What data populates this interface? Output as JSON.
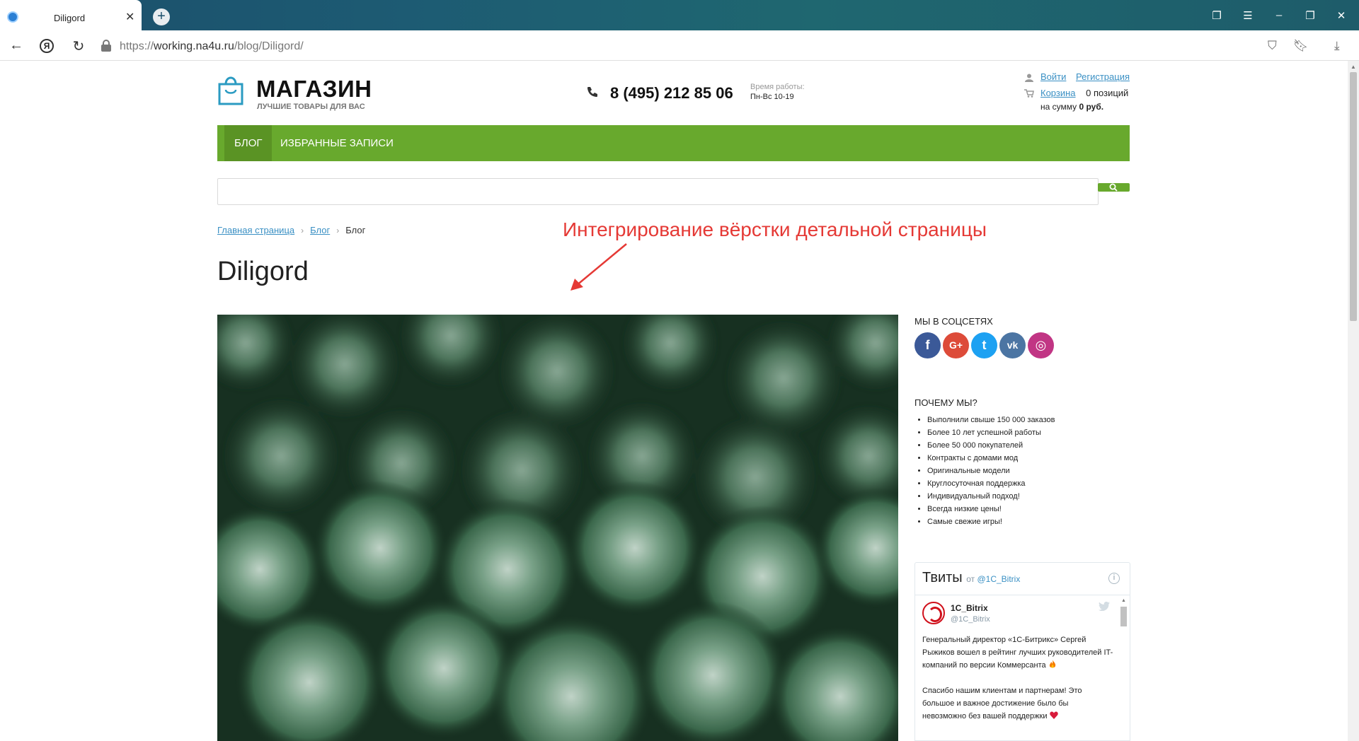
{
  "browser": {
    "tab_title": "Diligord",
    "url_prefix": "https://",
    "url_domain": "working.na4u.ru",
    "url_path": "/blog/Diligord/"
  },
  "header": {
    "logo_name": "МАГАЗИН",
    "logo_slogan": "ЛУЧШИЕ ТОВАРЫ ДЛЯ ВАС",
    "phone": "8 (495) 212 85 06",
    "hours_label": "Время работы:",
    "hours_value": "Пн-Вс 10-19",
    "login_link": "Войти",
    "register_link": "Регистрация",
    "cart_link": "Корзина",
    "cart_count": "0 позиций",
    "cart_sum_label": "на сумму",
    "cart_sum_value": "0 руб."
  },
  "menu": {
    "items": [
      {
        "label": "БЛОГ",
        "active": true
      },
      {
        "label": "ИЗБРАННЫЕ ЗАПИСИ",
        "active": false
      }
    ]
  },
  "search": {
    "placeholder": ""
  },
  "breadcrumbs": {
    "items": [
      {
        "label": "Главная страница",
        "link": true
      },
      {
        "label": "Блог",
        "link": true
      },
      {
        "label": "Блог",
        "link": false
      }
    ]
  },
  "annotation": "Интегрирование вёрстки детальной страницы",
  "page_title": "Diligord",
  "sidebar": {
    "social_title": "МЫ В СОЦСЕТЯХ",
    "social": [
      {
        "name": "facebook-icon",
        "glyph": "f",
        "color": "#3b5998"
      },
      {
        "name": "google-plus-icon",
        "glyph": "G+",
        "color": "#dd4b39"
      },
      {
        "name": "twitter-icon",
        "glyph": "t",
        "color": "#1da1f2"
      },
      {
        "name": "vk-icon",
        "glyph": "vk",
        "color": "#4c75a3"
      },
      {
        "name": "instagram-icon",
        "glyph": "◎",
        "color": "#c13584"
      }
    ],
    "why_title": "ПОЧЕМУ МЫ?",
    "why_items": [
      "Выполнили свыше 150 000 заказов",
      "Более 10 лет успешной работы",
      "Более 50 000 покупателей",
      "Контракты с домами мод",
      "Оригинальные модели",
      "Круглосуточная поддержка",
      "Индивидуальный подход!",
      "Всегда низкие цены!",
      "Самые свежие игры!"
    ],
    "tweets": {
      "title": "Твиты",
      "by_label": "от",
      "by_account": "@1C_Bitrix",
      "account_name": "1C_Bitrix",
      "account_handle": "@1C_Bitrix",
      "paragraph1": "Генеральный директор «1С-Битрикс» Сергей Рыжиков вошел в рейтинг лучших руководителей IT-компаний по версии Коммерсанта",
      "paragraph2": "Спасибо нашим клиентам и партнерам! Это большое и важное достижение было бы невозможно без вашей поддержки"
    }
  },
  "colors": {
    "menu_green": "#68a92d",
    "menu_active": "#5a9324",
    "link_blue": "#3a90c4",
    "annotation_red": "#e53935",
    "logo_teal": "#2b9bc2"
  }
}
